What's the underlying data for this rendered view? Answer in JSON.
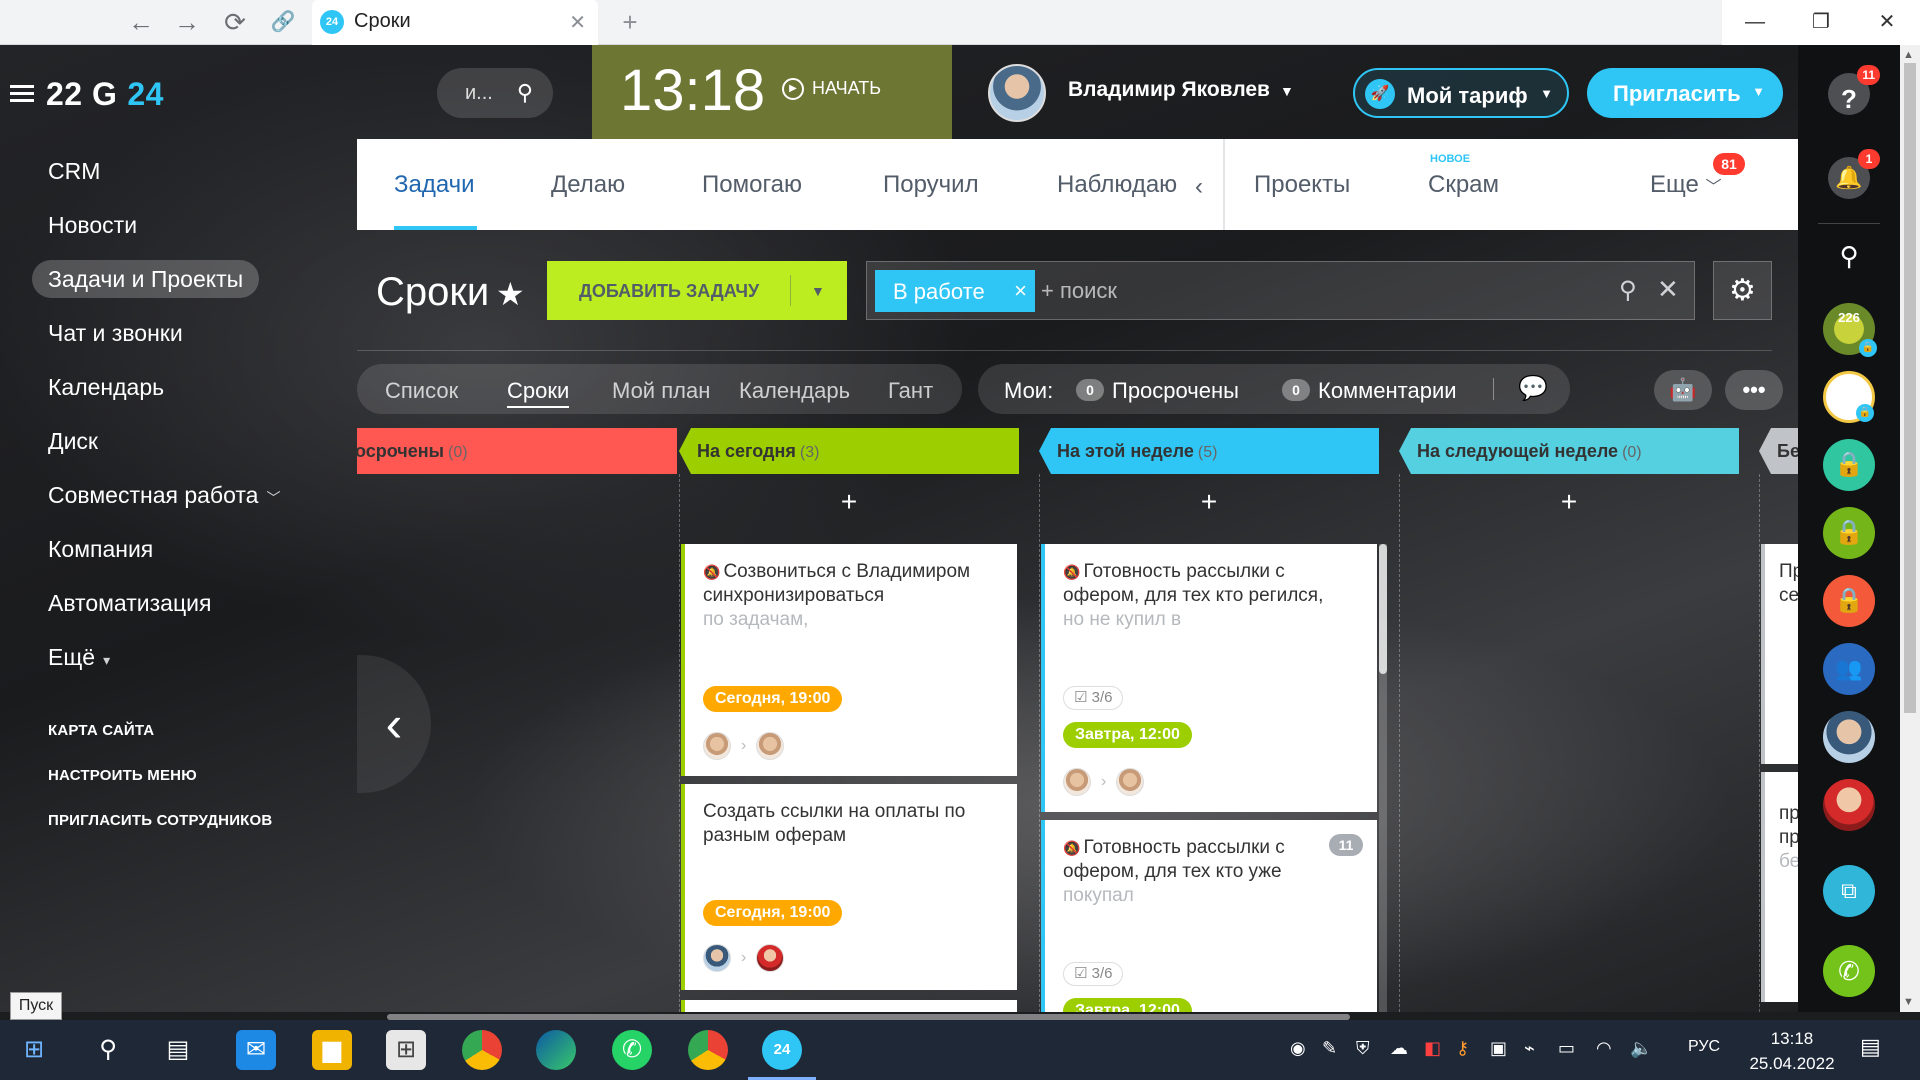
{
  "browser": {
    "back": "←",
    "forward": "→",
    "reload": "⟳",
    "link": "🔗",
    "tab_favicon": "24",
    "tab_title": "Сроки",
    "tab_close": "✕",
    "new_tab": "+",
    "window_buttons": [
      "—",
      "❐",
      "✕"
    ]
  },
  "sidebar": {
    "logo_main": "22 G",
    "logo_accent": "24",
    "items": [
      {
        "label": "CRM"
      },
      {
        "label": "Новости"
      },
      {
        "label": "Задачи и Проекты",
        "active": true
      },
      {
        "label": "Чат и звонки"
      },
      {
        "label": "Календарь"
      },
      {
        "label": "Диск"
      },
      {
        "label": "Совместная работа"
      },
      {
        "label": "Компания"
      },
      {
        "label": "Автоматизация"
      },
      {
        "label": "Ещё"
      }
    ],
    "links": [
      "КАРТА САЙТА",
      "НАСТРОИТЬ МЕНЮ",
      "ПРИГЛАСИТЬ СОТРУДНИКОВ"
    ]
  },
  "header": {
    "search_placeholder": "и...",
    "clock_time": "13:18",
    "start_label": "НАЧАТЬ",
    "user_name": "Владимир Яковлев",
    "tariff_label": "Мой тариф",
    "invite_label": "Пригласить"
  },
  "right_panel": {
    "help_badge": "11",
    "bell_badge": "1",
    "chat_label_1": "226"
  },
  "tabs": {
    "items": [
      "Задачи",
      "Делаю",
      "Помогаю",
      "Поручил",
      "Наблюдаю",
      "Проекты",
      "Скрам",
      "Еще"
    ],
    "scrum_new": "НОВОЕ",
    "more_badge": "81"
  },
  "page": {
    "title": "Сроки",
    "add_task": "ДОБАВИТЬ ЗАДАЧУ",
    "filter_chip": "В работе",
    "filter_placeholder": "+ поиск"
  },
  "views": [
    "Список",
    "Сроки",
    "Мой план",
    "Календарь",
    "Гант"
  ],
  "counters": {
    "label": "Мои:",
    "overdue_count": "0",
    "overdue_label": "Просрочены",
    "comments_count": "0",
    "comments_label": "Комментарии"
  },
  "columns": [
    {
      "title": "осрочены",
      "count": "(0)",
      "color": "#ff5752"
    },
    {
      "title": "На сегодня",
      "count": "(3)",
      "color": "#9dcf00"
    },
    {
      "title": "На этой неделе",
      "count": "(5)",
      "color": "#2fc6f6"
    },
    {
      "title": "На следующей неделе",
      "count": "(0)",
      "color": "#55d0e0"
    },
    {
      "title": "Бе",
      "count": "",
      "color": "#c0c3c7"
    }
  ],
  "cards": {
    "today": [
      {
        "title": "Созвониться с Владимиром синхронизироваться",
        "fade": "по задачам,",
        "deadline": "Сегодня, 19:00"
      },
      {
        "title": "Создать ссылки на оплаты по разным оферам",
        "fade": "",
        "deadline": "Сегодня, 19:00"
      }
    ],
    "week": [
      {
        "title": "Готовность рассылки с офером, для тех кто регился,",
        "fade": "но не купил в",
        "checklist": "3/6",
        "deadline": "Завтра, 12:00"
      },
      {
        "title": "Готовность рассылки с офером, для тех кто уже",
        "fade": "покупал",
        "checklist": "3/6",
        "deadline": "Завтра, 12:00",
        "comments": "11"
      }
    ],
    "next_partial": [
      "Пр",
      "се",
      "пр",
      "пр",
      "бе"
    ]
  },
  "colors": {
    "accent": "#2fc6f6",
    "today": "#9dcf00",
    "deadline_today": "#ffa900",
    "deadline_tomorrow": "#9dcf00",
    "overdue": "#ff5752"
  },
  "taskbar": {
    "start_tooltip": "Пуск",
    "lang": "РУС",
    "time": "13:18",
    "date": "25.04.2022"
  }
}
